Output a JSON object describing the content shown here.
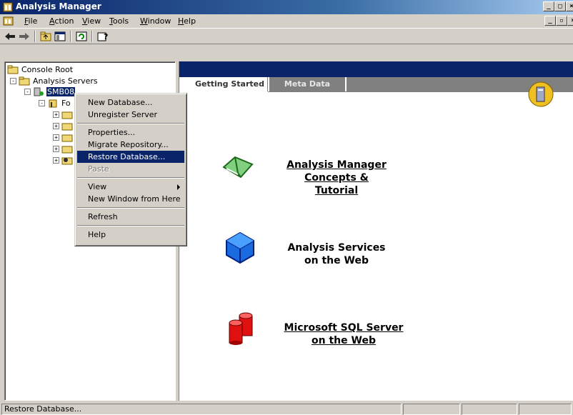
{
  "window": {
    "title": "Analysis Manager",
    "minimize": "_",
    "maximize": "□",
    "close": "×"
  },
  "menubar": {
    "items": [
      {
        "acc": "F",
        "rest": "ile"
      },
      {
        "acc": "A",
        "rest": "ction"
      },
      {
        "acc": "V",
        "rest": "iew"
      },
      {
        "acc": "T",
        "rest": "ools"
      },
      {
        "acc": "W",
        "rest": "indow"
      },
      {
        "acc": "H",
        "rest": "elp"
      }
    ],
    "mdi_minimize": "_",
    "mdi_restore": "▫",
    "mdi_close": "×"
  },
  "toolbar": {
    "buttons": [
      "back-icon",
      "forward-icon",
      "up-folder-icon",
      "show-hide-tree-icon",
      "refresh-icon",
      "help-icon"
    ]
  },
  "tree": {
    "root": "Console Root",
    "analysis_servers": "Analysis Servers",
    "server": "SMB08",
    "foodmart": "Fo"
  },
  "content": {
    "tabs": [
      "Getting Started",
      "Meta Data"
    ],
    "links": [
      {
        "lines": [
          "Analysis Manager",
          "Concepts &",
          "Tutorial"
        ],
        "icon": "book-icon"
      },
      {
        "lines": [
          "Analysis Services",
          "on the Web"
        ],
        "icon": "cube-icon"
      },
      {
        "lines": [
          "Microsoft SQL Server",
          "on the Web"
        ],
        "icon": "database-icon"
      }
    ]
  },
  "context_menu": {
    "new_database": "New Database...",
    "unregister_server": "Unregister Server",
    "properties": "Properties...",
    "migrate_repository": "Migrate Repository...",
    "restore_database": "Restore Database...",
    "paste": "Paste",
    "view": "View",
    "new_window": "New Window from Here",
    "refresh": "Refresh",
    "help": "Help"
  },
  "status": {
    "text": "Restore Database..."
  },
  "colors": {
    "title_bar": "#0a246a",
    "highlight": "#0a246a",
    "face": "#d4d0c8"
  }
}
